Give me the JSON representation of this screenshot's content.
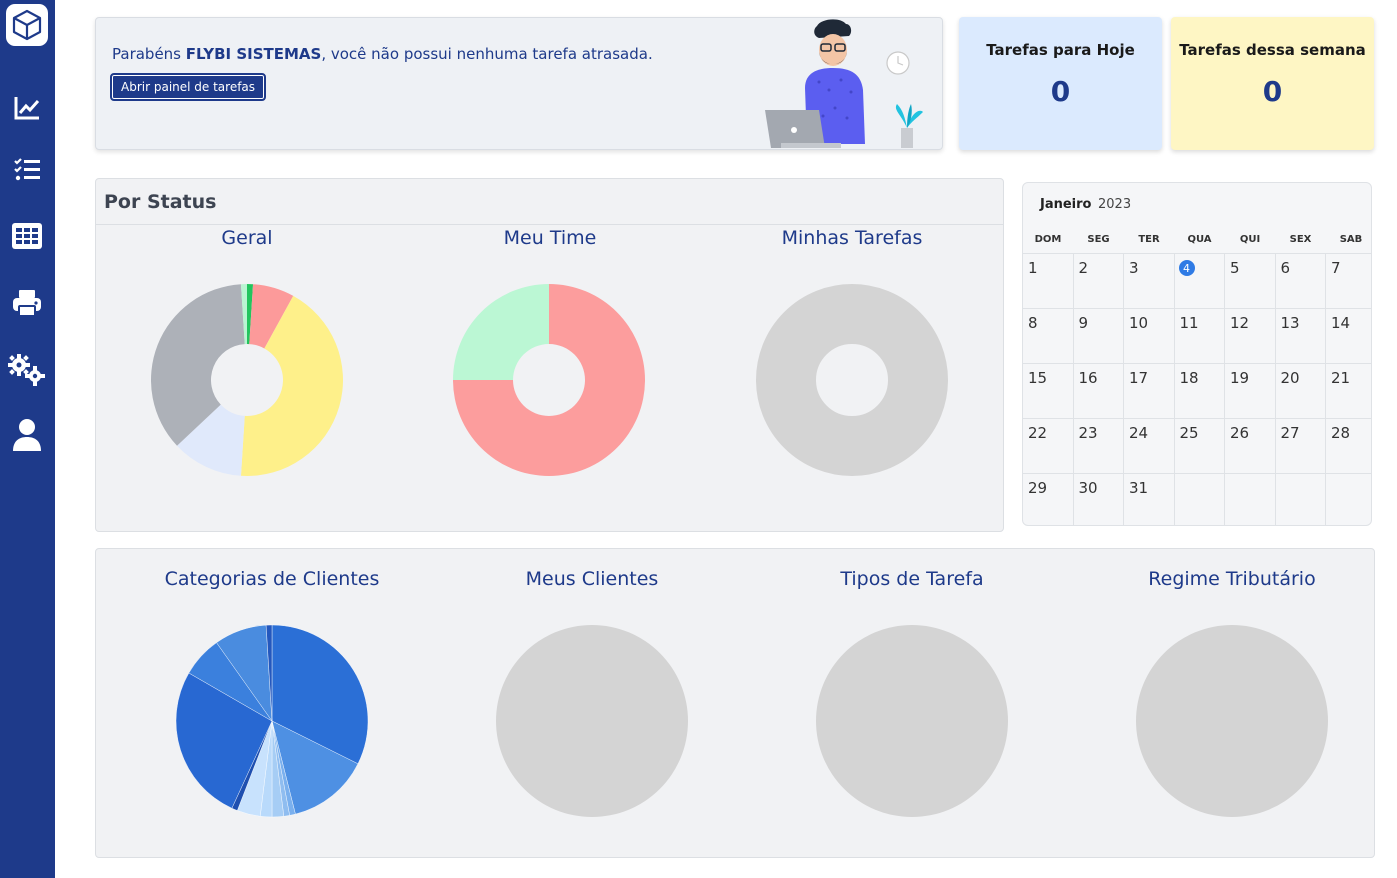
{
  "sidebar": {
    "logo": "box-logo-icon",
    "items": [
      {
        "icon": "chart-line-icon"
      },
      {
        "icon": "task-list-icon"
      },
      {
        "icon": "grid-table-icon"
      },
      {
        "icon": "printer-icon"
      },
      {
        "icon": "gears-icon"
      },
      {
        "icon": "user-icon"
      }
    ]
  },
  "banner": {
    "prefix": "Parabéns ",
    "user": "FLYBI SISTEMAS",
    "suffix": ", você não possui nenhuma tarefa atrasada.",
    "button": "Abrir painel de tarefas"
  },
  "stats": {
    "today": {
      "title": "Tarefas para Hoje",
      "value": "0"
    },
    "week": {
      "title": "Tarefas dessa semana",
      "value": "0"
    }
  },
  "status_panel": {
    "title": "Por Status",
    "charts": [
      "Geral",
      "Meu Time",
      "Minhas Tarefas"
    ]
  },
  "calendar": {
    "month": "Janeiro",
    "year": "2023",
    "weekdays": [
      "DOM",
      "SEG",
      "TER",
      "QUA",
      "QUI",
      "SEX",
      "SAB"
    ],
    "days": [
      1,
      2,
      3,
      4,
      5,
      6,
      7,
      8,
      9,
      10,
      11,
      12,
      13,
      14,
      15,
      16,
      17,
      18,
      19,
      20,
      21,
      22,
      23,
      24,
      25,
      26,
      27,
      28,
      29,
      30,
      31
    ],
    "today": 4
  },
  "clients_panel": {
    "charts": [
      "Categorias de Clientes",
      "Meus Clientes",
      "Tipos de Tarefa",
      "Regime Tributário"
    ]
  },
  "chart_data": [
    {
      "type": "pie",
      "title": "Geral",
      "donut": true,
      "values": [
        1,
        7,
        43,
        12,
        36,
        1
      ],
      "colors": [
        "#22c55e",
        "#fc9a9a",
        "#fef08a",
        "#e0e9fb",
        "#adb1b8",
        "#b9f5d2"
      ]
    },
    {
      "type": "pie",
      "title": "Meu Time",
      "donut": true,
      "values": [
        75,
        25
      ],
      "colors": [
        "#fc9d9d",
        "#bbf7d4"
      ]
    },
    {
      "type": "pie",
      "title": "Minhas Tarefas",
      "donut": true,
      "values": [
        1
      ],
      "colors": [
        "#d4d4d4"
      ]
    },
    {
      "type": "pie",
      "title": "Categorias de Clientes",
      "donut": false,
      "values": [
        33,
        14,
        1,
        1,
        2,
        2,
        4,
        1,
        27,
        7,
        9,
        1
      ],
      "colors": [
        "#2b6fd6",
        "#4e90e3",
        "#7ab0ee",
        "#8fbdf0",
        "#a6cdf5",
        "#b9dafb",
        "#c8e2fd",
        "#1e4fb0",
        "#2868d2",
        "#3b80dd",
        "#4a8cdf",
        "#2458be"
      ]
    },
    {
      "type": "pie",
      "title": "Meus Clientes",
      "donut": false,
      "values": [
        1
      ],
      "colors": [
        "#d4d4d4"
      ]
    },
    {
      "type": "pie",
      "title": "Tipos de Tarefa",
      "donut": false,
      "values": [
        1
      ],
      "colors": [
        "#d4d4d4"
      ]
    },
    {
      "type": "pie",
      "title": "Regime Tributário",
      "donut": false,
      "values": [
        1
      ],
      "colors": [
        "#d4d4d4"
      ]
    }
  ]
}
